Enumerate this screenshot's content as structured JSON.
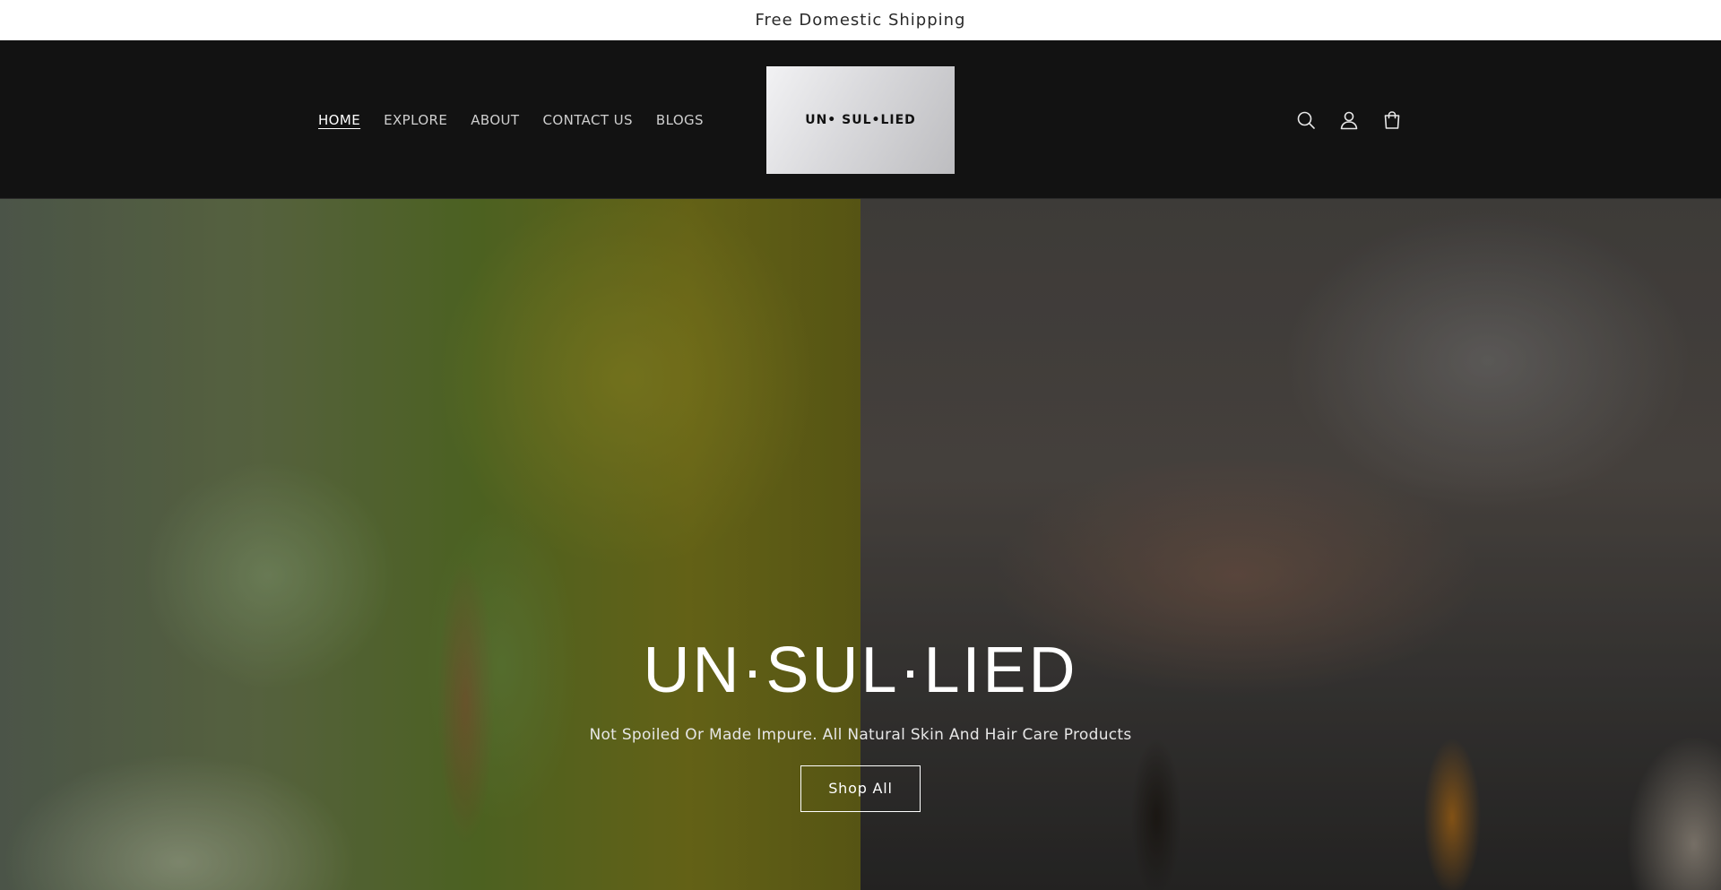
{
  "announcement": {
    "text": "Free Domestic Shipping"
  },
  "nav": {
    "items": [
      {
        "label": "HOME",
        "active": true
      },
      {
        "label": "EXPLORE",
        "active": false
      },
      {
        "label": "ABOUT",
        "active": false
      },
      {
        "label": "CONTACT US",
        "active": false
      },
      {
        "label": "BLOGS",
        "active": false
      }
    ]
  },
  "logo": {
    "text": "UN• SUL•LIED"
  },
  "header_icons": [
    "search-icon",
    "account-icon",
    "cart-icon"
  ],
  "hero": {
    "title": "UN·SUL·LIED",
    "subtitle": "Not Spoiled Or Made Impure. All Natural Skin And Hair Care Products",
    "button_label": "Shop All"
  },
  "colors": {
    "header_bg": "#121212",
    "announce_bg": "#ffffff",
    "text_light": "#ffffff"
  }
}
